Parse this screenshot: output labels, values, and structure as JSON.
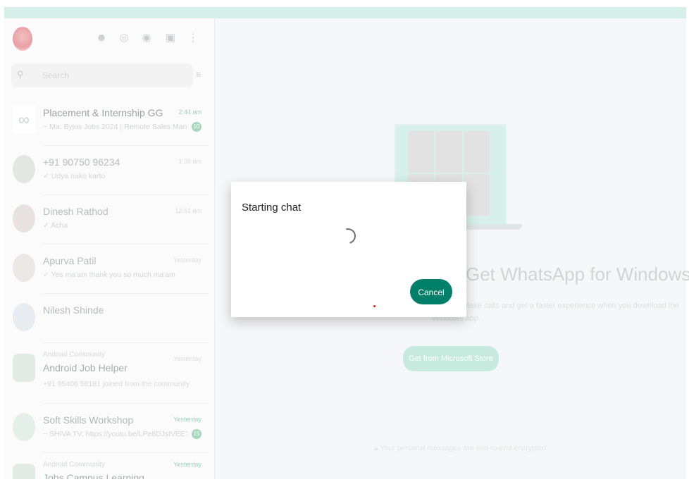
{
  "sidebar": {
    "search_placeholder": "Search",
    "icons": [
      "communities-icon",
      "status-icon",
      "channels-icon",
      "new-chat-icon",
      "menu-icon"
    ],
    "chats": [
      {
        "name": "Placement & Internship GG",
        "preview": "~ Ma: Byjus Jobs 2024 | Remote Sales Manage...",
        "time": "2:44 am",
        "badge": "10"
      },
      {
        "name": "+91 90750 96234",
        "preview": "✓ Udya nako karto",
        "time": "1:38 am"
      },
      {
        "name": "Dinesh Rathod",
        "preview": "✓ Acha",
        "time": "12:51 am"
      },
      {
        "name": "Apurva Patil",
        "preview": "✓ Yes ma'am thank you so much ma'am",
        "time": "Yesterday"
      },
      {
        "name": "Nilesh Shinde",
        "preview": "",
        "time": ""
      },
      {
        "group": "Android Community",
        "name": "Android Job Helper",
        "preview": "+91 95406 58181 joined from the community",
        "time": "Yesterday"
      },
      {
        "name": "Soft Skills Workshop",
        "preview": "~ SHIVA TV: https://youtu.be/LPe8DJstVEE?si...",
        "time": "Yesterday",
        "badge": "15"
      },
      {
        "group": "Android Community",
        "name": "Jobs Campus Learning",
        "preview": "",
        "time": "Yesterday"
      }
    ]
  },
  "main": {
    "title": "Get WhatsApp for Windows",
    "desc_line1": "Make calls and get a faster experience when you download the",
    "desc_line2": "Windows app.",
    "store_button": "Get from Microsoft Store",
    "encrypted": "Your personal messages are end-to-end encrypted"
  },
  "dialog": {
    "title": "Starting chat",
    "cancel": "Cancel"
  },
  "colors": {
    "accent": "#008069",
    "topbar": "#d6efe9"
  }
}
